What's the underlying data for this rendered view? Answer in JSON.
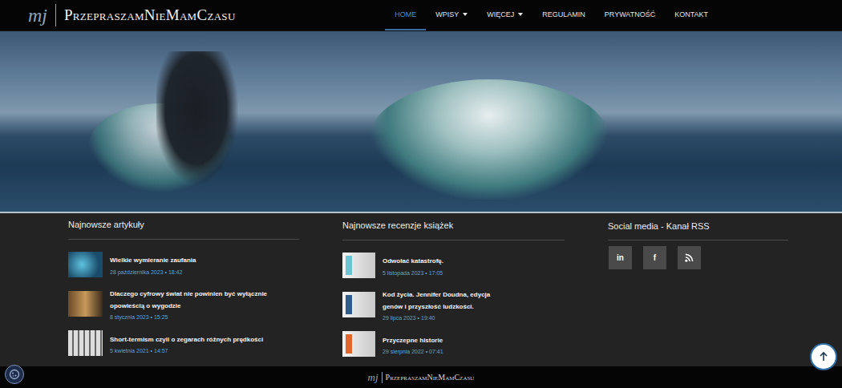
{
  "site": {
    "logo_mark": "mj",
    "title": "PrzepraszamNieMamCzasu"
  },
  "nav": [
    {
      "label": "HOME",
      "selected": true,
      "dropdown": false
    },
    {
      "label": "WPISY",
      "selected": false,
      "dropdown": true
    },
    {
      "label": "WIĘCEJ",
      "selected": false,
      "dropdown": true
    },
    {
      "label": "REGULAMIN",
      "selected": false,
      "dropdown": false
    },
    {
      "label": "PRYWATNOŚĆ",
      "selected": false,
      "dropdown": false
    },
    {
      "label": "KONTAKT",
      "selected": false,
      "dropdown": false
    }
  ],
  "articles": {
    "title": "Najnowsze artykuły",
    "items": [
      {
        "title": "Wielkie wymieranie zaufania",
        "date": "28 października 2023 • 18:42"
      },
      {
        "title": "Dlaczego cyfrowy świat nie powinien być wyłącznie opowieścią o wygodzie",
        "date": "8 stycznia 2023 • 15:25"
      },
      {
        "title": "Short-termism czyli o zegarach różnych prędkości",
        "date": "5 kwietnia 2021 • 14:57"
      }
    ]
  },
  "books": {
    "title": "Najnowsze recenzje książek",
    "items": [
      {
        "title": "Odwołać katastrofę.",
        "date": "5 listopada 2023 • 17:05"
      },
      {
        "title": "Kod życia. Jennifer Doudna, edycja genów i przyszłość ludzkości.",
        "date": "29 lipca 2023 • 19:40"
      },
      {
        "title": "Przyczepne historie",
        "date": "29 sierpnia 2022 • 07:41"
      }
    ]
  },
  "social": {
    "title": "Social media - Kanał RSS",
    "buttons": [
      {
        "kind": "text",
        "glyph": "in"
      },
      {
        "kind": "text",
        "glyph": "f"
      },
      {
        "kind": "rss",
        "glyph": ""
      }
    ]
  },
  "footer": {
    "logo_mark": "mj",
    "title": "PrzepraszamNieMamCzasu"
  }
}
